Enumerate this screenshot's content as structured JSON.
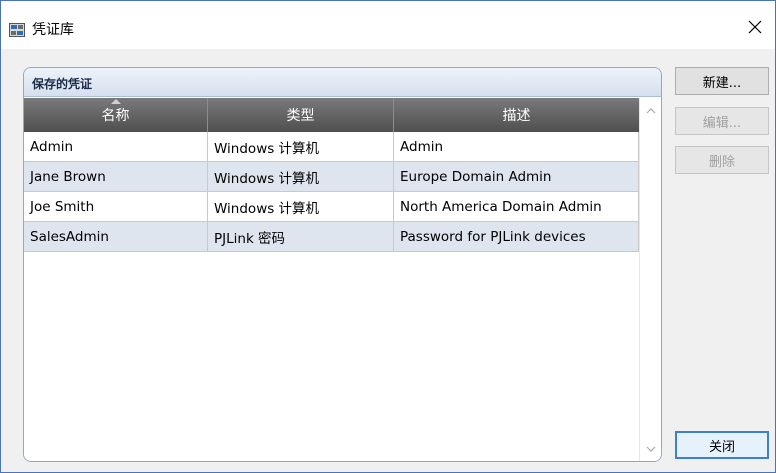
{
  "window": {
    "title": "凭证库",
    "close_symbol": "✕"
  },
  "group": {
    "title": "保存的凭证"
  },
  "table": {
    "columns": [
      "名称",
      "类型",
      "描述"
    ],
    "rows": [
      {
        "name": "Admin",
        "type": "Windows 计算机",
        "description": "Admin"
      },
      {
        "name": "Jane Brown",
        "type": "Windows 计算机",
        "description": "Europe Domain Admin"
      },
      {
        "name": "Joe Smith",
        "type": "Windows 计算机",
        "description": "North America Domain Admin"
      },
      {
        "name": "SalesAdmin",
        "type": "PJLink 密码",
        "description": "Password for PJLink devices"
      }
    ]
  },
  "buttons": {
    "new_label": "新建...",
    "edit_label": "编辑...",
    "delete_label": "删除",
    "close_label": "关闭"
  },
  "colors": {
    "header_dark": "#5a5a5a",
    "alt_row": "#dfe5ef",
    "window_border": "#4a74b8",
    "primary_button_border": "#3c7fd1"
  }
}
